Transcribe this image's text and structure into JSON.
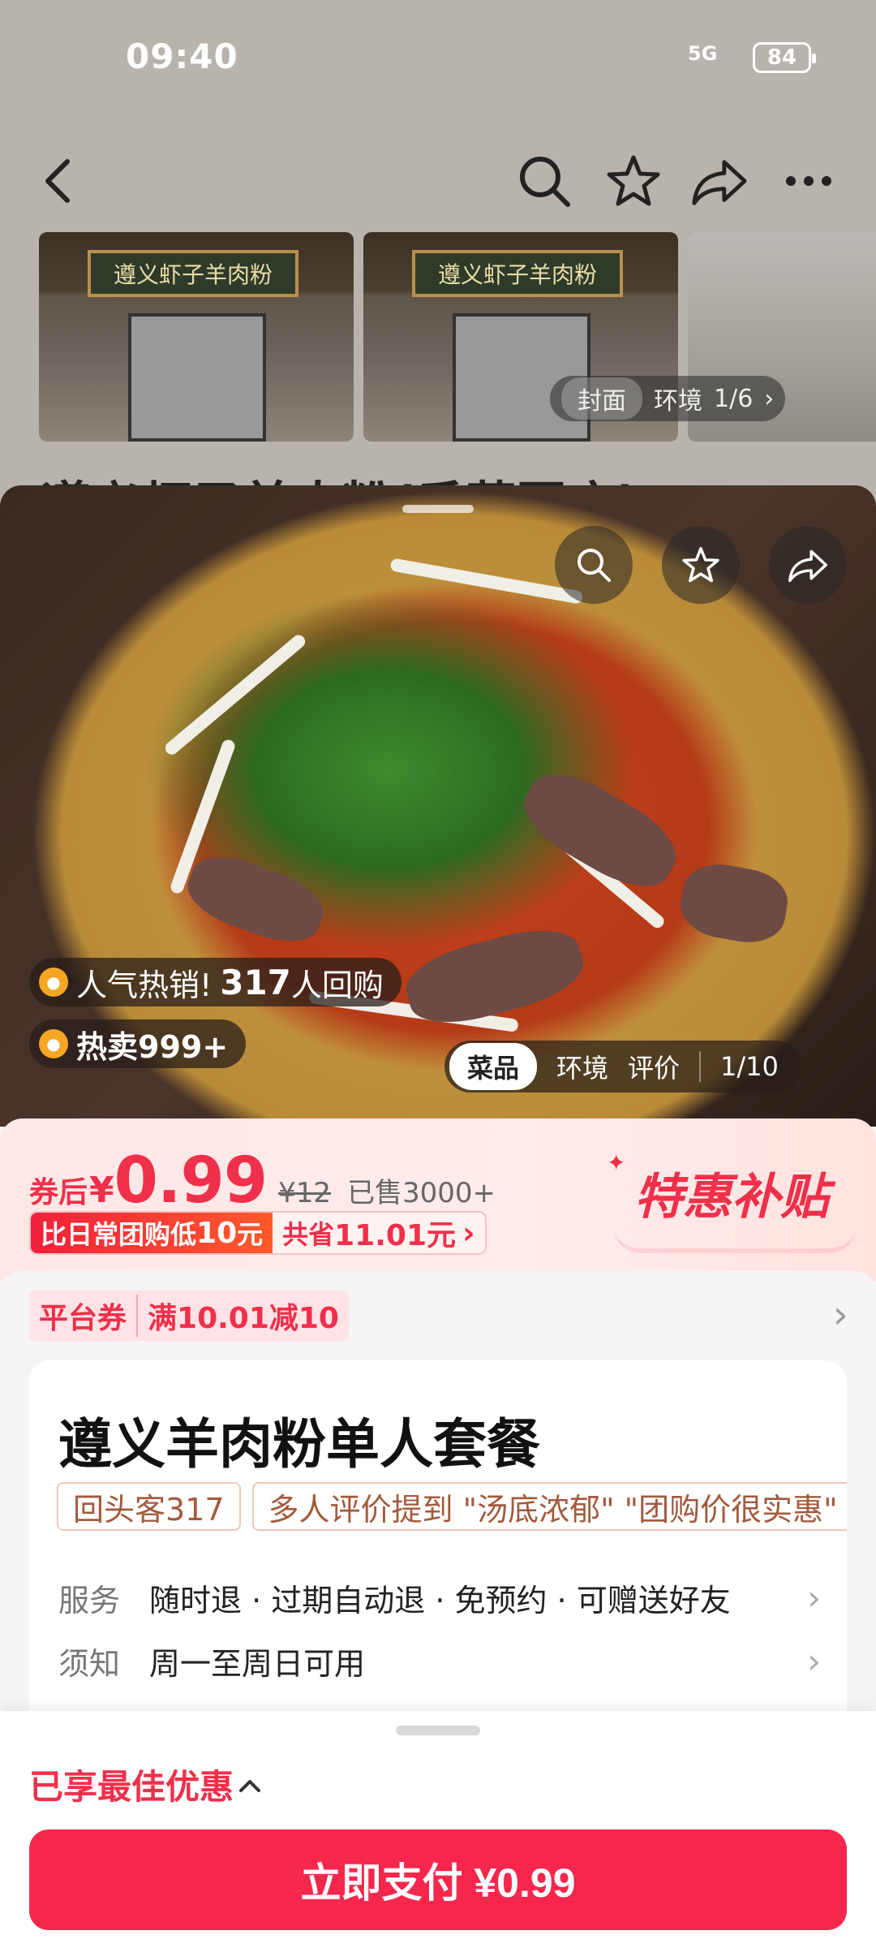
{
  "status_bar": {
    "time": "09:40",
    "signal": "5G",
    "battery": "84"
  },
  "store": {
    "title_peek": "遵义虾子羊肉粉(香草园店)",
    "photo_signs": [
      "遵义虾子羊肉粉",
      "遵义虾子羊肉粉"
    ],
    "photo_tabs": {
      "cover": "封面",
      "environment": "环境",
      "counter": "1/6"
    }
  },
  "hero": {
    "badge_popular_prefix": "人气热销!",
    "badge_popular_count": "317",
    "badge_popular_suffix": "人回购",
    "badge_hot": "热卖999+",
    "tabs": {
      "dish": "菜品",
      "environment": "环境",
      "review": "评价",
      "counter": "1/10"
    }
  },
  "price": {
    "prefix": "券后",
    "currency": "¥",
    "value": "0.99",
    "original": "¥12",
    "sold": "已售3000+",
    "subsidy": "特惠补贴",
    "promo_a_prefix": "比日常团购低",
    "promo_a_amount": "10",
    "promo_a_unit": "元",
    "promo_b_prefix": "共省",
    "promo_b_amount": "11.01元",
    "promo_b_chev": "›"
  },
  "coupon": {
    "type": "平台券",
    "rule": "满10.01减10"
  },
  "deal": {
    "title": "遵义羊肉粉单人套餐",
    "tags": [
      "回头客317",
      "多人评价提到 \"汤底浓郁\" \"团购价很实惠\""
    ],
    "service_label": "服务",
    "service_value": "随时退 · 过期自动退 · 免预约 · 可赠送好友",
    "notice_label": "须知",
    "notice_value": "周一至周日可用"
  },
  "bottom": {
    "best_offer": "已享最佳优惠",
    "pay_label": "立即支付 ¥0.99"
  },
  "colors": {
    "accent": "#f0304a",
    "pay": "#f7264c"
  },
  "icons": [
    "back-icon",
    "search-icon",
    "star-icon",
    "share-icon",
    "more-icon"
  ]
}
